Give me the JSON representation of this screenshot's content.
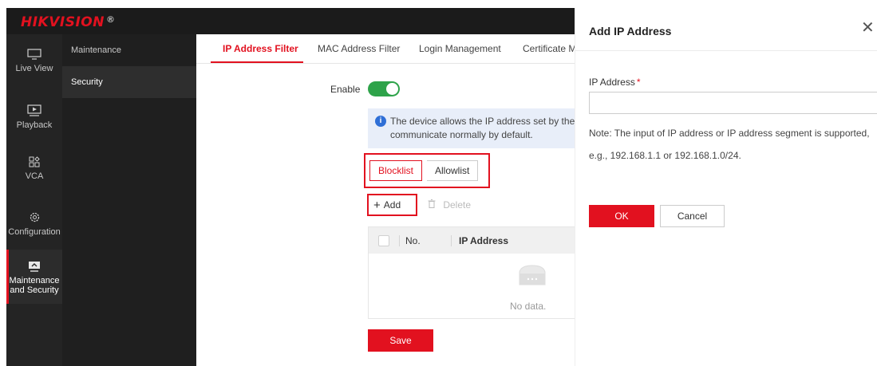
{
  "brand": {
    "logo": "HIKVISION",
    "reg": "®",
    "accent": "#e2111f"
  },
  "leftnav": [
    {
      "label": "Live View",
      "icon": "monitor-icon"
    },
    {
      "label": "Playback",
      "icon": "playback-icon"
    },
    {
      "label": "VCA",
      "icon": "vca-icon"
    },
    {
      "label": "Configuration",
      "icon": "gear-icon"
    },
    {
      "label": "Maintenance and Security",
      "icon": "maintenance-icon",
      "active": true
    }
  ],
  "subnav": [
    {
      "label": "Maintenance"
    },
    {
      "label": "Security",
      "active": true
    }
  ],
  "tabs": [
    {
      "label": "IP Address Filter",
      "active": true
    },
    {
      "label": "MAC Address Filter"
    },
    {
      "label": "Login Management"
    },
    {
      "label": "Certificate M"
    }
  ],
  "main": {
    "enable_label": "Enable",
    "enable_on": true,
    "info_line1": "The device allows the IP address set by the",
    "info_line2": "communicate normally by default.",
    "segments": [
      "Blocklist",
      "Allowlist"
    ],
    "add_label": "Add",
    "delete_label": "Delete",
    "table_headers": {
      "no": "No.",
      "ip": "IP Address"
    },
    "empty_text": "No data.",
    "save_label": "Save"
  },
  "dialog": {
    "title": "Add IP Address",
    "close_glyph": "✕",
    "ip_label": "IP Address",
    "required_mark": "*",
    "ip_value": "",
    "note": "Note: The input of IP address or IP address segment is supported,",
    "example": "e.g., 192.168.1.1 or 192.168.1.0/24.",
    "ok_label": "OK",
    "cancel_label": "Cancel"
  }
}
